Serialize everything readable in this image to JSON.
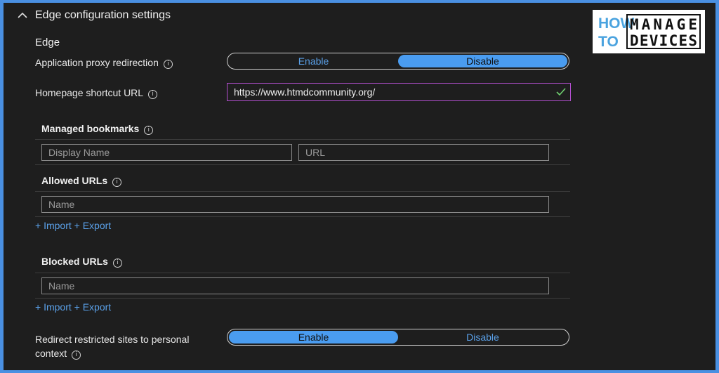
{
  "header": {
    "title": "Edge configuration settings",
    "collapse_icon": "chevron-up-icon"
  },
  "section": {
    "label": "Edge"
  },
  "app_proxy": {
    "label": "Application proxy redirection",
    "options": [
      "Enable",
      "Disable"
    ],
    "selected": "Disable"
  },
  "homepage": {
    "label": "Homepage shortcut URL",
    "value": "https://www.htmdcommunity.org/",
    "valid_icon": "checkmark-icon"
  },
  "bookmarks": {
    "label": "Managed bookmarks",
    "name_placeholder": "Display Name",
    "url_placeholder": "URL"
  },
  "allowed": {
    "label": "Allowed URLs",
    "placeholder": "Name",
    "import": "+ Import",
    "export": "+ Export"
  },
  "blocked": {
    "label": "Blocked URLs",
    "placeholder": "Name",
    "import": "+ Import",
    "export": "+ Export"
  },
  "redirect": {
    "label_line1": "Redirect restricted sites to personal",
    "label_line2": "context",
    "options": [
      "Enable",
      "Disable"
    ],
    "selected": "Enable"
  },
  "logo": {
    "top_left": "HOW",
    "bottom_left": "TO",
    "top_right": "MANAGE",
    "bottom_right": "DEVICES"
  },
  "colors": {
    "accent": "#4a9cf0",
    "link": "#5aa0e8",
    "valid": "#6fcf6f",
    "focus_border": "#b34fd0",
    "frame": "#4a90e2"
  }
}
